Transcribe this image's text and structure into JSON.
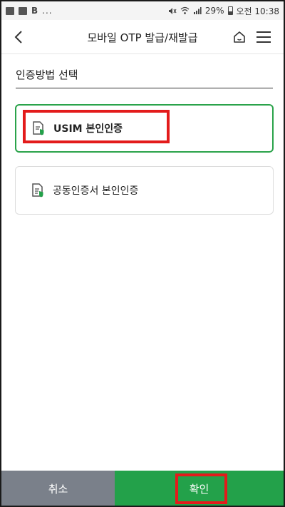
{
  "status_bar": {
    "left_text": "B",
    "dots": "...",
    "battery": "29%",
    "time": "오전 10:38"
  },
  "header": {
    "title": "모바일 OTP 발급/재발급"
  },
  "section": {
    "title": "인증방법 선택"
  },
  "options": [
    {
      "label": "USIM 본인인증",
      "selected": true
    },
    {
      "label": "공동인증서 본인인증",
      "selected": false
    }
  ],
  "buttons": {
    "cancel": "취소",
    "confirm": "확인"
  },
  "colors": {
    "accent_green": "#23a14a",
    "selected_border": "#2aa34a",
    "cancel_gray": "#7a808a",
    "highlight_red": "#e31b1b"
  },
  "icons": {
    "back": "chevron-left-icon",
    "home": "home-icon",
    "menu": "hamburger-menu-icon",
    "option": "document-shield-icon"
  }
}
